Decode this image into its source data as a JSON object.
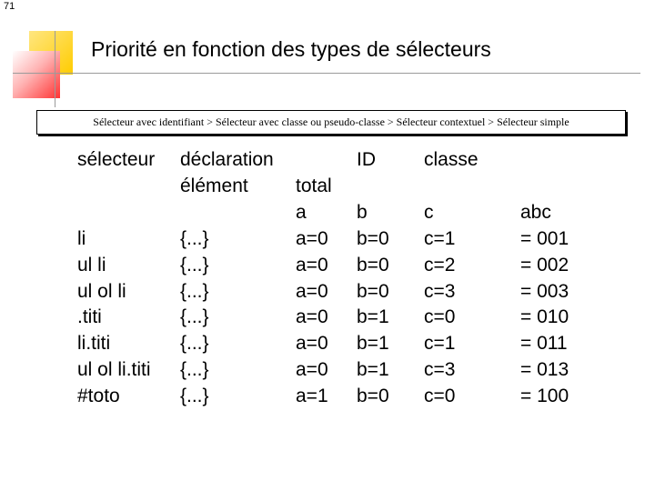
{
  "slide_number": "71",
  "title": "Priorité en fonction des types de sélecteurs",
  "info_box": "Sélecteur avec identifiant > Sélecteur avec classe ou pseudo-classe > Sélecteur contextuel > Sélecteur simple",
  "table": {
    "header_row1": {
      "selector": "sélecteur",
      "declaration": "déclaration",
      "id": "ID",
      "classe": "classe"
    },
    "header_row2": {
      "element": "élément",
      "total": "total"
    },
    "header_row3": {
      "a": "a",
      "b": "b",
      "c": "c",
      "abc": "abc"
    },
    "rows": [
      {
        "selector": "li",
        "declaration": "{...}",
        "a": "a=0",
        "b": "b=0",
        "c": "c=1",
        "total": "= 001"
      },
      {
        "selector": "ul li",
        "declaration": "{...}",
        "a": "a=0",
        "b": "b=0",
        "c": "c=2",
        "total": "= 002"
      },
      {
        "selector": "ul ol li",
        "declaration": "{...}",
        "a": "a=0",
        "b": "b=0",
        "c": "c=3",
        "total": "= 003"
      },
      {
        "selector": ".titi",
        "declaration": "{...}",
        "a": "a=0",
        "b": "b=1",
        "c": "c=0",
        "total": "= 010"
      },
      {
        "selector": "li.titi",
        "declaration": "{...}",
        "a": "a=0",
        "b": "b=1",
        "c": "c=1",
        "total": "= 011"
      },
      {
        "selector": "ul ol li.titi",
        "declaration": "{...}",
        "a": "a=0",
        "b": "b=1",
        "c": "c=3",
        "total": "= 013"
      },
      {
        "selector": "#toto",
        "declaration": "{...}",
        "a": "a=1",
        "b": "b=0",
        "c": "c=0",
        "total": "= 100"
      }
    ]
  }
}
